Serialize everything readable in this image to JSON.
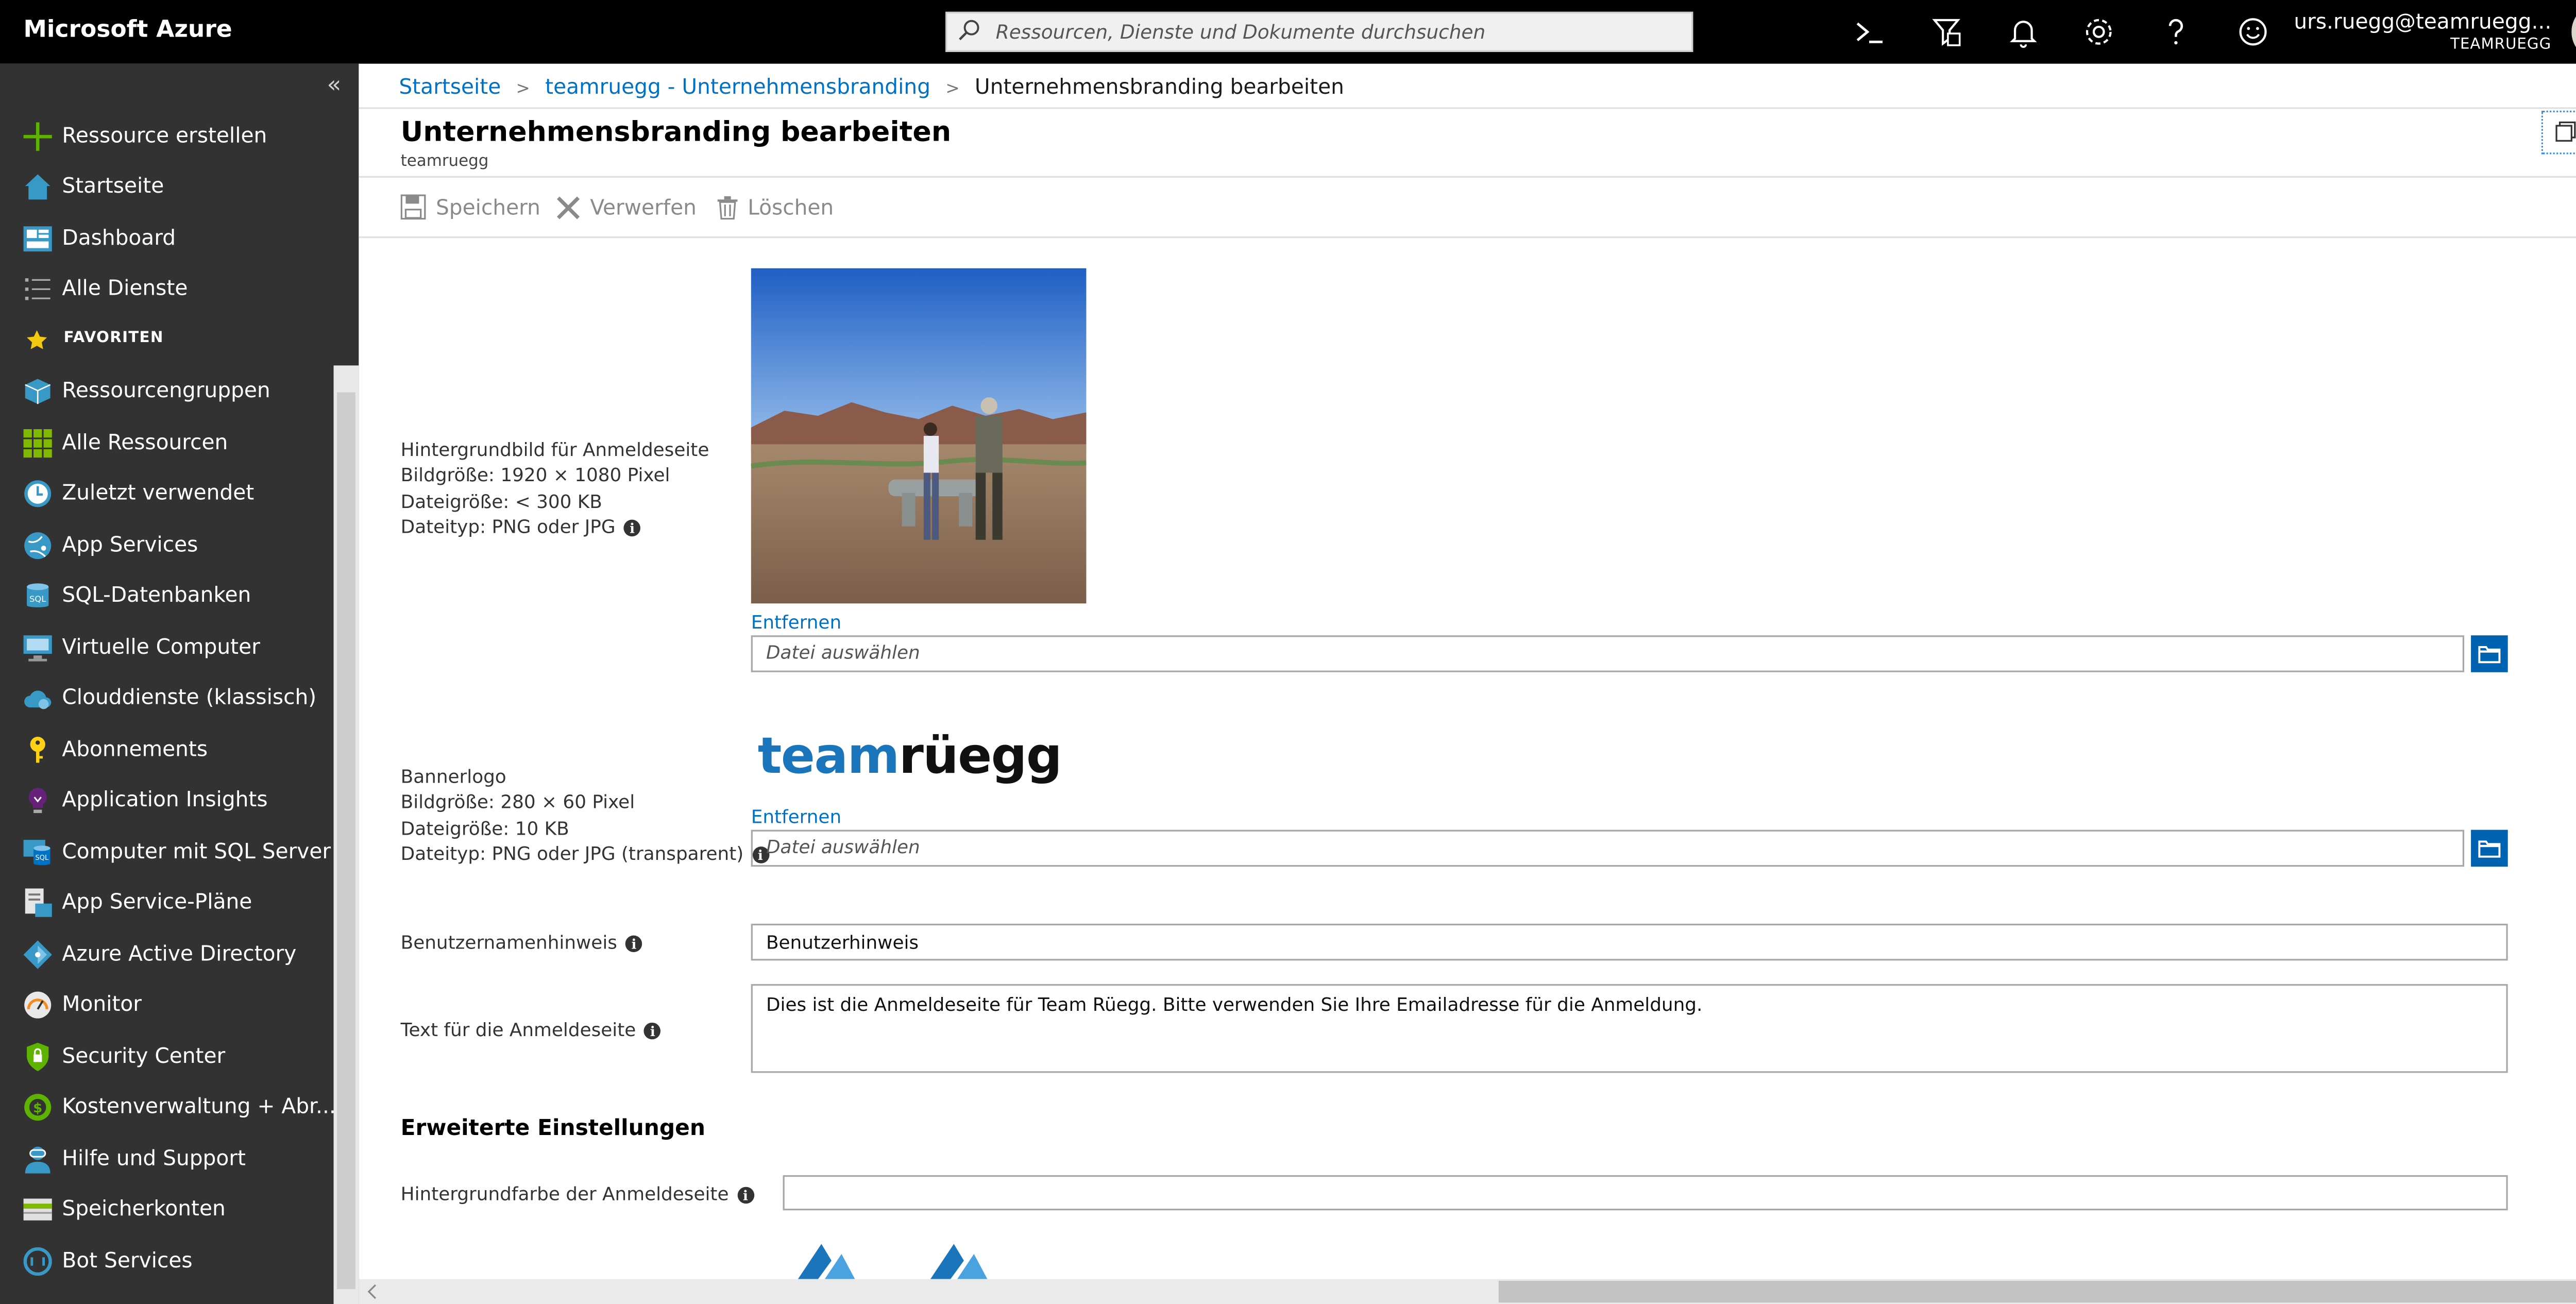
{
  "topbar": {
    "brand": "Microsoft Azure",
    "search_placeholder": "Ressourcen, Dienste und Dokumente durchsuchen",
    "user_email": "urs.ruegg@teamruegg...",
    "user_tenant": "TEAMRUEGG",
    "icons": [
      "cloud-shell-icon",
      "directory-filter-icon",
      "notifications-icon",
      "settings-icon",
      "help-icon",
      "feedback-icon"
    ]
  },
  "sidebar": {
    "collapse_glyph": "«",
    "items": [
      {
        "label": "Ressource erstellen",
        "icon": "plus-icon"
      },
      {
        "label": "Startseite",
        "icon": "home-icon"
      },
      {
        "label": "Dashboard",
        "icon": "dashboard-icon"
      },
      {
        "label": "Alle Dienste",
        "icon": "list-icon"
      }
    ],
    "favorites_header": "FAVORITEN",
    "favorites": [
      {
        "label": "Ressourcengruppen",
        "icon": "resource-group-icon"
      },
      {
        "label": "Alle Ressourcen",
        "icon": "all-resources-icon"
      },
      {
        "label": "Zuletzt verwendet",
        "icon": "clock-icon"
      },
      {
        "label": "App Services",
        "icon": "app-services-icon"
      },
      {
        "label": "SQL-Datenbanken",
        "icon": "sql-database-icon"
      },
      {
        "label": "Virtuelle Computer",
        "icon": "virtual-machine-icon"
      },
      {
        "label": "Clouddienste (klassisch)",
        "icon": "cloud-service-icon"
      },
      {
        "label": "Abonnements",
        "icon": "key-icon"
      },
      {
        "label": "Application Insights",
        "icon": "lightbulb-icon"
      },
      {
        "label": "Computer mit SQL Server",
        "icon": "sql-server-vm-icon"
      },
      {
        "label": "App Service-Pläne",
        "icon": "app-service-plan-icon"
      },
      {
        "label": "Azure Active Directory",
        "icon": "active-directory-icon"
      },
      {
        "label": "Monitor",
        "icon": "monitor-icon"
      },
      {
        "label": "Security Center",
        "icon": "shield-icon"
      },
      {
        "label": "Kostenverwaltung + Abr...",
        "icon": "cost-management-icon"
      },
      {
        "label": "Hilfe und Support",
        "icon": "help-support-icon"
      },
      {
        "label": "Speicherkonten",
        "icon": "storage-account-icon"
      },
      {
        "label": "Bot Services",
        "icon": "bot-services-icon"
      }
    ]
  },
  "breadcrumb": {
    "items": [
      "Startseite",
      "teamruegg - Unternehmensbranding"
    ],
    "current": "Unternehmensbranding bearbeiten"
  },
  "blade": {
    "title": "Unternehmensbranding bearbeiten",
    "subtitle": "teamruegg"
  },
  "commands": {
    "save": "Speichern",
    "discard": "Verwerfen",
    "delete": "Löschen"
  },
  "form": {
    "background": {
      "title": "Hintergrundbild für Anmeldeseite",
      "size": "Bildgröße: 1920 × 1080 Pixel",
      "filesize": "Dateigröße: < 300 KB",
      "filetype": "Dateityp: PNG oder JPG",
      "remove": "Entfernen",
      "file_placeholder": "Datei auswählen"
    },
    "banner": {
      "title": "Bannerlogo",
      "size": "Bildgröße: 280 × 60 Pixel",
      "filesize": "Dateigröße: 10 KB",
      "filetype": "Dateityp: PNG oder JPG (transparent)",
      "logo_part1": "team",
      "logo_part2": "rüegg",
      "remove": "Entfernen",
      "file_placeholder": "Datei auswählen"
    },
    "username_hint": {
      "label": "Benutzernamenhinweis",
      "value": "Benutzerhinweis"
    },
    "signin_text": {
      "label": "Text für die Anmeldeseite",
      "value": "Dies ist die Anmeldeseite für Team Rüegg. Bitte verwenden Sie Ihre Emailadresse für die Anmeldung."
    },
    "advanced_header": "Erweiterte Einstellungen",
    "bg_color": {
      "label": "Hintergrundfarbe der Anmeldeseite",
      "value": ""
    }
  },
  "colors": {
    "topbar": "#000000",
    "sidebar": "#323232",
    "link": "#0072c6",
    "browse_button": "#0063b1",
    "logo_blue": "#1b75bb"
  }
}
